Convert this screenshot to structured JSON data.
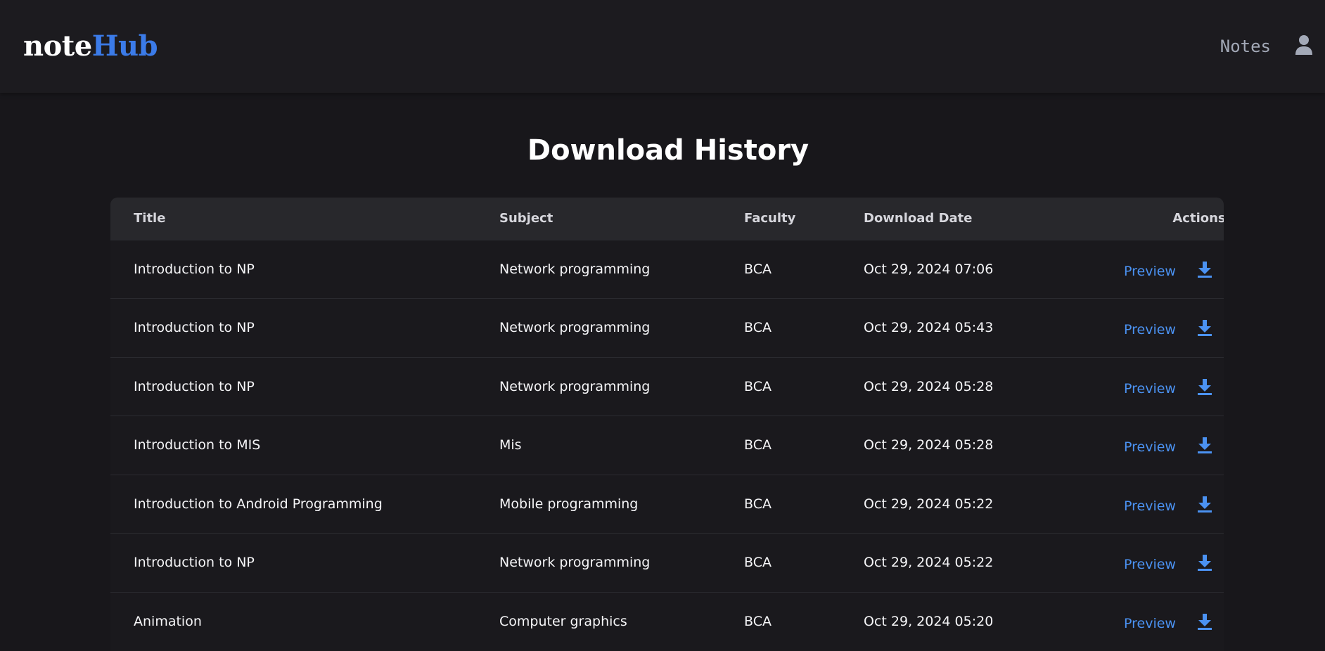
{
  "brand": {
    "logo_part1": "note",
    "logo_part2": "Hub"
  },
  "nav": {
    "notes_label": "Notes",
    "user_icon": "user-icon"
  },
  "page": {
    "title": "Download History"
  },
  "table": {
    "headers": {
      "title": "Title",
      "subject": "Subject",
      "faculty": "Faculty",
      "date": "Download Date",
      "actions": "Actions"
    },
    "preview_label": "Preview",
    "download_icon": "download-icon",
    "rows": [
      {
        "title": "Introduction to NP",
        "subject": "Network programming",
        "faculty": "BCA",
        "date": "Oct 29, 2024 07:06"
      },
      {
        "title": "Introduction to NP",
        "subject": "Network programming",
        "faculty": "BCA",
        "date": "Oct 29, 2024 05:43"
      },
      {
        "title": "Introduction to NP",
        "subject": "Network programming",
        "faculty": "BCA",
        "date": "Oct 29, 2024 05:28"
      },
      {
        "title": "Introduction to MIS",
        "subject": "Mis",
        "faculty": "BCA",
        "date": "Oct 29, 2024 05:28"
      },
      {
        "title": "Introduction to Android Programming",
        "subject": "Mobile programming",
        "faculty": "BCA",
        "date": "Oct 29, 2024 05:22"
      },
      {
        "title": "Introduction to NP",
        "subject": "Network programming",
        "faculty": "BCA",
        "date": "Oct 29, 2024 05:22"
      },
      {
        "title": "Animation",
        "subject": "Computer graphics",
        "faculty": "BCA",
        "date": "Oct 29, 2024 05:20"
      }
    ]
  },
  "colors": {
    "background": "#18171b",
    "navbar": "#1c1b1f",
    "accent": "#3b7be8",
    "link": "#4b92f2",
    "header_row": "#28282c"
  }
}
